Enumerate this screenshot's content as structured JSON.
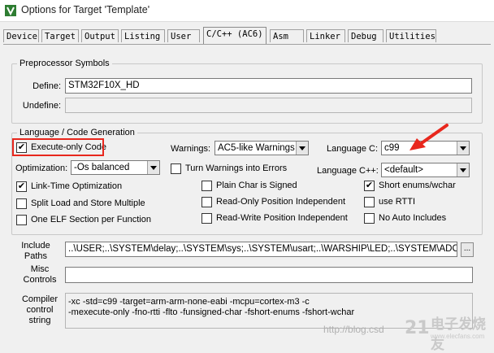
{
  "window": {
    "title": "Options for Target 'Template'"
  },
  "tabs": [
    {
      "label": "Device"
    },
    {
      "label": "Target"
    },
    {
      "label": "Output"
    },
    {
      "label": "Listing"
    },
    {
      "label": "User"
    },
    {
      "label": "C/C++ (AC6)"
    },
    {
      "label": "Asm"
    },
    {
      "label": "Linker"
    },
    {
      "label": "Debug"
    },
    {
      "label": "Utilities"
    }
  ],
  "preprocessor": {
    "group_title": "Preprocessor Symbols",
    "define_label": "Define:",
    "define_value": "STM32F10X_HD",
    "undefine_label": "Undefine:",
    "undefine_value": ""
  },
  "language": {
    "group_title": "Language / Code Generation",
    "execute_only": {
      "label": "Execute-only Code",
      "checked": true
    },
    "warnings_label": "Warnings:",
    "warnings_value": "AC5-like Warnings",
    "language_c_label": "Language C:",
    "language_c_value": "c99",
    "optimization_label": "Optimization:",
    "optimization_value": "-Os balanced",
    "turn_warnings": {
      "label": "Turn Warnings into Errors",
      "checked": false
    },
    "language_cpp_label": "Language C++:",
    "language_cpp_value": "<default>",
    "link_time": {
      "label": "Link-Time Optimization",
      "checked": true
    },
    "plain_char": {
      "label": "Plain Char is Signed",
      "checked": false
    },
    "short_enums": {
      "label": "Short enums/wchar",
      "checked": true
    },
    "split_load": {
      "label": "Split Load and Store Multiple",
      "checked": false
    },
    "ropi": {
      "label": "Read-Only Position Independent",
      "checked": false
    },
    "use_rtti": {
      "label": "use RTTI",
      "checked": false
    },
    "one_elf": {
      "label": "One ELF Section per Function",
      "checked": false
    },
    "rwpi": {
      "label": "Read-Write Position Independent",
      "checked": false
    },
    "no_auto_includes": {
      "label": "No Auto Includes",
      "checked": false
    }
  },
  "include": {
    "label": "Include\nPaths",
    "value": "..\\USER;..\\SYSTEM\\delay;..\\SYSTEM\\sys;..\\SYSTEM\\usart;..\\WARSHIP\\LED;..\\SYSTEM\\ADC;..",
    "browse_label": "..."
  },
  "misc": {
    "label": "Misc\nControls",
    "value": ""
  },
  "compiler": {
    "label": "Compiler\ncontrol\nstring",
    "line1": "-xc -std=c99 -target=arm-arm-none-eabi -mcpu=cortex-m3 -c",
    "line2": "-mexecute-only -fno-rtti -flto -funsigned-char -fshort-enums -fshort-wchar"
  },
  "overlay": {
    "watermark": "http://blog.csd",
    "brand_text": "电子发烧友",
    "brand_domain": "www.elecfans.com",
    "highlight_color": "#e8271d"
  }
}
